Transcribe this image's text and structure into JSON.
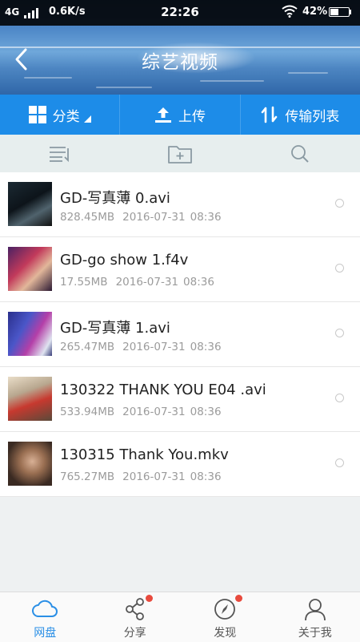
{
  "status_bar": {
    "network": "4G",
    "speed": "0.6K/s",
    "time": "22:26",
    "battery": "42%",
    "battery_level": 0.42
  },
  "header": {
    "title": "综艺视频"
  },
  "toolbar": {
    "category_label": "分类",
    "upload_label": "上传",
    "transfer_label": "传输列表"
  },
  "files": [
    {
      "name": "GD-写真薄 0.avi",
      "size": "828.45MB",
      "date": "2016-07-31",
      "time": "08:36",
      "thumb_colors": [
        "#0f1a22",
        "#2d3b44",
        "#6b7f88"
      ]
    },
    {
      "name": "GD-go show 1.f4v",
      "size": "17.55MB",
      "date": "2016-07-31",
      "time": "08:36",
      "thumb_colors": [
        "#3a1f4e",
        "#c43a5a",
        "#e2b79a"
      ]
    },
    {
      "name": "GD-写真薄 1.avi",
      "size": "265.47MB",
      "date": "2016-07-31",
      "time": "08:36",
      "thumb_colors": [
        "#2a2f8c",
        "#b43fa8",
        "#dfe4f0"
      ]
    },
    {
      "name": "130322 THANK YOU E04 .avi",
      "size": "533.94MB",
      "date": "2016-07-31",
      "time": "08:36",
      "thumb_colors": [
        "#b8a78f",
        "#c7392f",
        "#e9ddc8"
      ]
    },
    {
      "name": "130315 Thank You.mkv",
      "size": "765.27MB",
      "date": "2016-07-31",
      "time": "08:36",
      "thumb_colors": [
        "#3a2a22",
        "#9a6f52",
        "#d8b095"
      ]
    }
  ],
  "bottom_nav": [
    {
      "label": "网盘",
      "icon": "cloud-icon",
      "active": true,
      "badge": false
    },
    {
      "label": "分享",
      "icon": "share-icon",
      "active": false,
      "badge": true
    },
    {
      "label": "发现",
      "icon": "compass-icon",
      "active": false,
      "badge": true
    },
    {
      "label": "关于我",
      "icon": "person-icon",
      "active": false,
      "badge": false
    }
  ],
  "colors": {
    "toolbar_blue": "#1d8ce8",
    "active_nav": "#2b8fe6",
    "badge_red": "#e84a3d"
  }
}
